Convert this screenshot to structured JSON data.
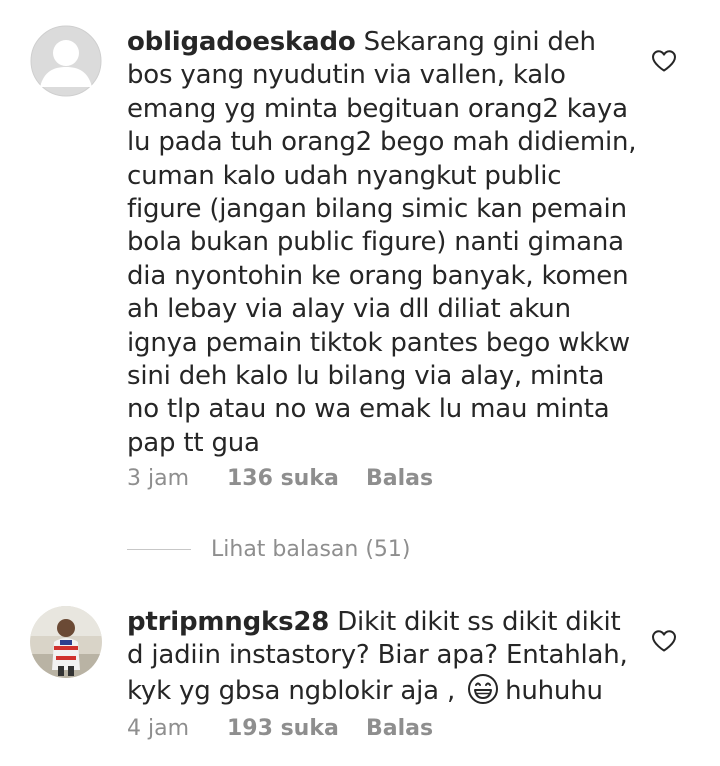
{
  "comments": [
    {
      "username": "obligadoeskado",
      "text": "Sekarang gini deh bos yang nyudutin via vallen, kalo emang yg minta begituan orang2 kaya lu pada tuh orang2 bego mah didiemin, cuman kalo udah nyangkut public figure (jangan bilang simic kan pemain bola bukan public figure) nanti gimana dia nyontohin ke orang banyak, komen ah lebay via alay via dll diliat akun ignya pemain tiktok pantes bego wkkw sini deh kalo lu bilang via alay, minta no tlp atau no wa emak lu mau minta pap tt gua",
      "time": "3 jam",
      "likes": "136 suka",
      "reply_label": "Balas",
      "avatar": "default-avatar-icon",
      "view_replies": "Lihat balasan (51)"
    },
    {
      "username": "ptripmngks28",
      "text_before_emoji": "Dikit dikit ss dikit dikit d jadiin instastory? Biar apa? Entahlah, kyk yg gbsa ngblokir aja ,",
      "emoji": "grinning-face-emoji",
      "text_after_emoji": "huhuhu",
      "time": "4 jam",
      "likes": "193 suka",
      "reply_label": "Balas",
      "avatar": "profile-photo"
    }
  ],
  "icons": {
    "like": "heart-outline-icon"
  },
  "colors": {
    "text": "#262626",
    "meta": "#8e8e8e",
    "avatar_bg": "#dbdbdb"
  }
}
